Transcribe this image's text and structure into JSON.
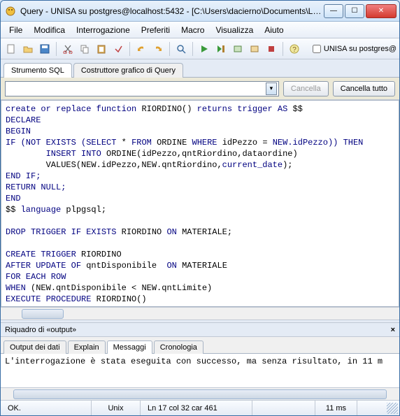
{
  "window": {
    "title": "Query - UNISA su postgres@localhost:5432 - [C:\\Users\\dacierno\\Documents\\La..."
  },
  "menu": {
    "items": [
      "File",
      "Modifica",
      "Interrogazione",
      "Preferiti",
      "Macro",
      "Visualizza",
      "Aiuto"
    ]
  },
  "toolbar_check": {
    "label": "UNISA su postgres@"
  },
  "maintabs": {
    "tabs": [
      {
        "label": "Strumento SQL"
      },
      {
        "label": "Costruttore grafico di Query"
      }
    ]
  },
  "controls": {
    "cancel": "Cancella",
    "cancel_all": "Cancella tutto"
  },
  "sql": {
    "line1a": "create or replace function",
    "line1b": "RIORDINO()",
    "line1c": "returns trigger AS",
    "line1d": "$$",
    "line2": "DECLARE",
    "line3": "BEGIN",
    "line4a": "IF",
    "line4b": "(NOT EXISTS",
    "line4c": "(SELECT",
    "line4d": "*",
    "line4e": "FROM",
    "line4f": "ORDINE",
    "line4g": "WHERE",
    "line4h": "idPezzo =",
    "line4i": "NEW.idPezzo))",
    "line4j": "THEN",
    "line5a": "INSERT INTO",
    "line5b": "ORDINE(idPezzo,qntRiordino,dataordine)",
    "line6a": "VALUES(NEW.idPezzo,NEW.qntRiordino,",
    "line6b": "current_date",
    "line6c": ");",
    "line7": "END IF;",
    "line8a": "RETURN",
    "line8b": "NULL;",
    "line9": "END",
    "line10a": "$$",
    "line10b": "language",
    "line10c": "plpgsql;",
    "line12a": "DROP TRIGGER IF EXISTS",
    "line12b": "RIORDINO",
    "line12c": "ON",
    "line12d": "MATERIALE;",
    "line14a": "CREATE TRIGGER",
    "line14b": "RIORDINO",
    "line15a": "AFTER UPDATE OF",
    "line15b": "qntDisponibile",
    "line15c": "ON",
    "line15d": "MATERIALE",
    "line16": "FOR EACH ROW",
    "line17a": "WHEN",
    "line17b": "(NEW.qntDisponibile < NEW.qntLimite)",
    "line18a": "EXECUTE PROCEDURE",
    "line18b": "RIORDINO()"
  },
  "output": {
    "title": "Riquadro di «output»",
    "tabs": [
      {
        "label": "Output dei dati"
      },
      {
        "label": "Explain"
      },
      {
        "label": "Messaggi"
      },
      {
        "label": "Cronologia"
      }
    ],
    "message": "L'interrogazione è stata eseguita con successo, ma senza risultato, in 11 m"
  },
  "status": {
    "ok": "OK.",
    "encoding": "Unix",
    "position": "Ln 17 col 32 car 461",
    "time": "11 ms"
  }
}
